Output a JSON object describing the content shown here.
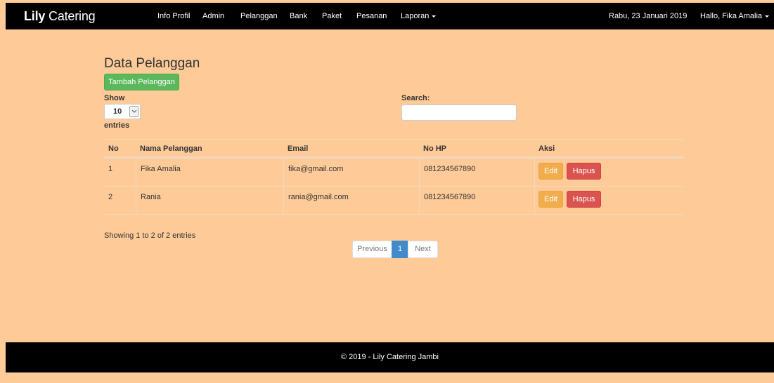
{
  "brand": {
    "bold": "Lily",
    "rest": " Catering"
  },
  "nav": {
    "items": [
      "Info Profil",
      "Admin",
      "Pelanggan",
      "Bank",
      "Paket",
      "Pesanan",
      "Laporan"
    ],
    "date": "Rabu, 23 Januari 2019",
    "user": "Hallo, Fika Amalia"
  },
  "main": {
    "title": "Data Pelanggan",
    "add_button": "Tambah Pelanggan",
    "show_label": "Show",
    "entries_select": "10",
    "entries_label": "entries",
    "search_label": "Search:",
    "search_value": ""
  },
  "table": {
    "headers": [
      "No",
      "Nama Pelanggan",
      "Email",
      "No HP",
      "Aksi"
    ],
    "rows": [
      {
        "no": "1",
        "nama": "Fika Amalia",
        "email": "fika@gmail.com",
        "hp": "081234567890",
        "edit": "Edit",
        "hapus": "Hapus"
      },
      {
        "no": "2",
        "nama": "Rania",
        "email": "rania@gmail.com",
        "hp": "081234567890",
        "edit": "Edit",
        "hapus": "Hapus"
      }
    ]
  },
  "info": "Showing 1 to 2 of 2 entries",
  "pagination": {
    "previous": "Previous",
    "current": "1",
    "next": "Next"
  },
  "footer": "© 2019 - Lily Catering Jambi",
  "colors": {
    "background": "#fecb98",
    "navbar": "#000000",
    "success": "#5cb85c",
    "warning": "#f0ad4e",
    "danger": "#d9534f",
    "primary": "#428bca"
  },
  "icons": {
    "user_menu": "caret-down-icon",
    "report_menu": "caret-down-icon",
    "select": "chevron-down-icon"
  }
}
